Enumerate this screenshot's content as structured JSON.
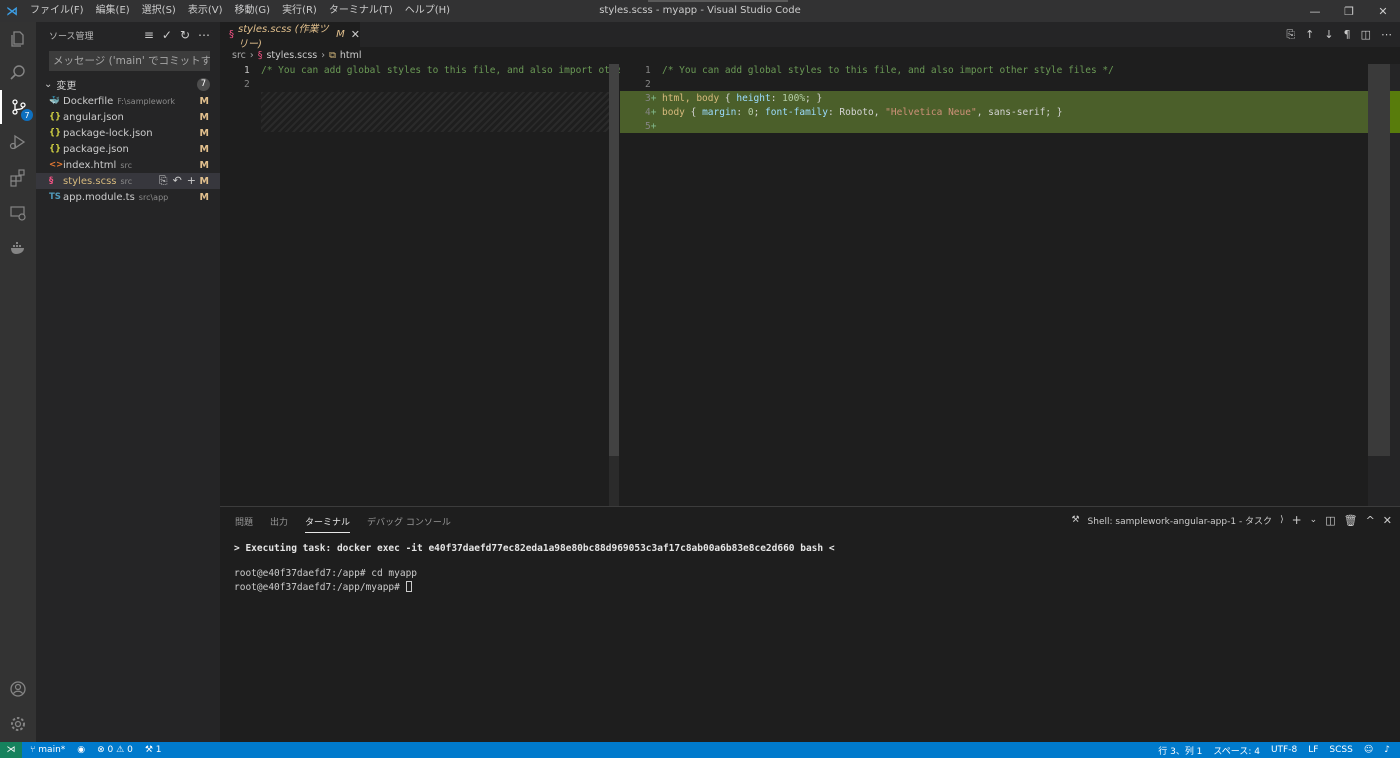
{
  "titlebar": {
    "menus": [
      "ファイル(F)",
      "編集(E)",
      "選択(S)",
      "表示(V)",
      "移動(G)",
      "実行(R)",
      "ターミナル(T)",
      "ヘルプ(H)"
    ],
    "window_title": "styles.scss - myapp - Visual Studio Code",
    "controls": [
      "—",
      "❐",
      "✕"
    ]
  },
  "activity": {
    "scm_badge": "7"
  },
  "sidebar": {
    "title": "ソース管理",
    "commit_placeholder": "メッセージ ('main' でコミットする...",
    "changes_label": "変更",
    "changes_count": "7",
    "files": [
      {
        "name": "Dockerfile",
        "path": "F:\\samplework",
        "status": "M",
        "icon": "🐳",
        "color": "#3c9ee5"
      },
      {
        "name": "angular.json",
        "path": "",
        "status": "M",
        "icon": "{}",
        "color": "#cbcb41"
      },
      {
        "name": "package-lock.json",
        "path": "",
        "status": "M",
        "icon": "{}",
        "color": "#cbcb41"
      },
      {
        "name": "package.json",
        "path": "",
        "status": "M",
        "icon": "{}",
        "color": "#cbcb41"
      },
      {
        "name": "index.html",
        "path": "src",
        "status": "M",
        "icon": "<>",
        "color": "#e37933"
      },
      {
        "name": "styles.scss",
        "path": "src",
        "status": "M",
        "icon": "§",
        "color": "#f55385"
      },
      {
        "name": "app.module.ts",
        "path": "src\\app",
        "status": "M",
        "icon": "TS",
        "color": "#519aba"
      }
    ]
  },
  "tab": {
    "label": "styles.scss (作業ツリー)",
    "status": "M"
  },
  "breadcrumb": {
    "parts": [
      "src",
      "styles.scss",
      "html"
    ]
  },
  "editor": {
    "left_line1": "/* You can add global styles to this file, and also import other",
    "right_line1": "/* You can add global styles to this file, and also import other style files */",
    "line3_sel": "html, body",
    "line3_prop": "height",
    "line3_val": "100%",
    "line4_sel": "body",
    "line4_prop1": "margin",
    "line4_val1": "0",
    "line4_prop2": "font-family",
    "line4_val2a": "Roboto, ",
    "line4_str": "\"Helvetica Neue\"",
    "line4_val2b": ", sans-serif"
  },
  "panel": {
    "tabs": [
      "問題",
      "出力",
      "ターミナル",
      "デバッグ コンソール"
    ],
    "shell_label": "Shell: samplework-angular-app-1 - タスク",
    "terminal_lines": [
      "> Executing task: docker exec -it e40f37daefd77ec82eda1a98e80bc88d969053c3af17c8ab00a6b83e8ce2d660 bash <",
      "",
      "root@e40f37daefd7:/app# cd myapp",
      "root@e40f37daefd7:/app/myapp# "
    ]
  },
  "statusbar": {
    "branch": "main*",
    "errors": "0",
    "warnings": "0",
    "ports": "1",
    "position": "行 3、列 1",
    "spaces": "スペース: 4",
    "encoding": "UTF-8",
    "eol": "LF",
    "language": "SCSS"
  }
}
